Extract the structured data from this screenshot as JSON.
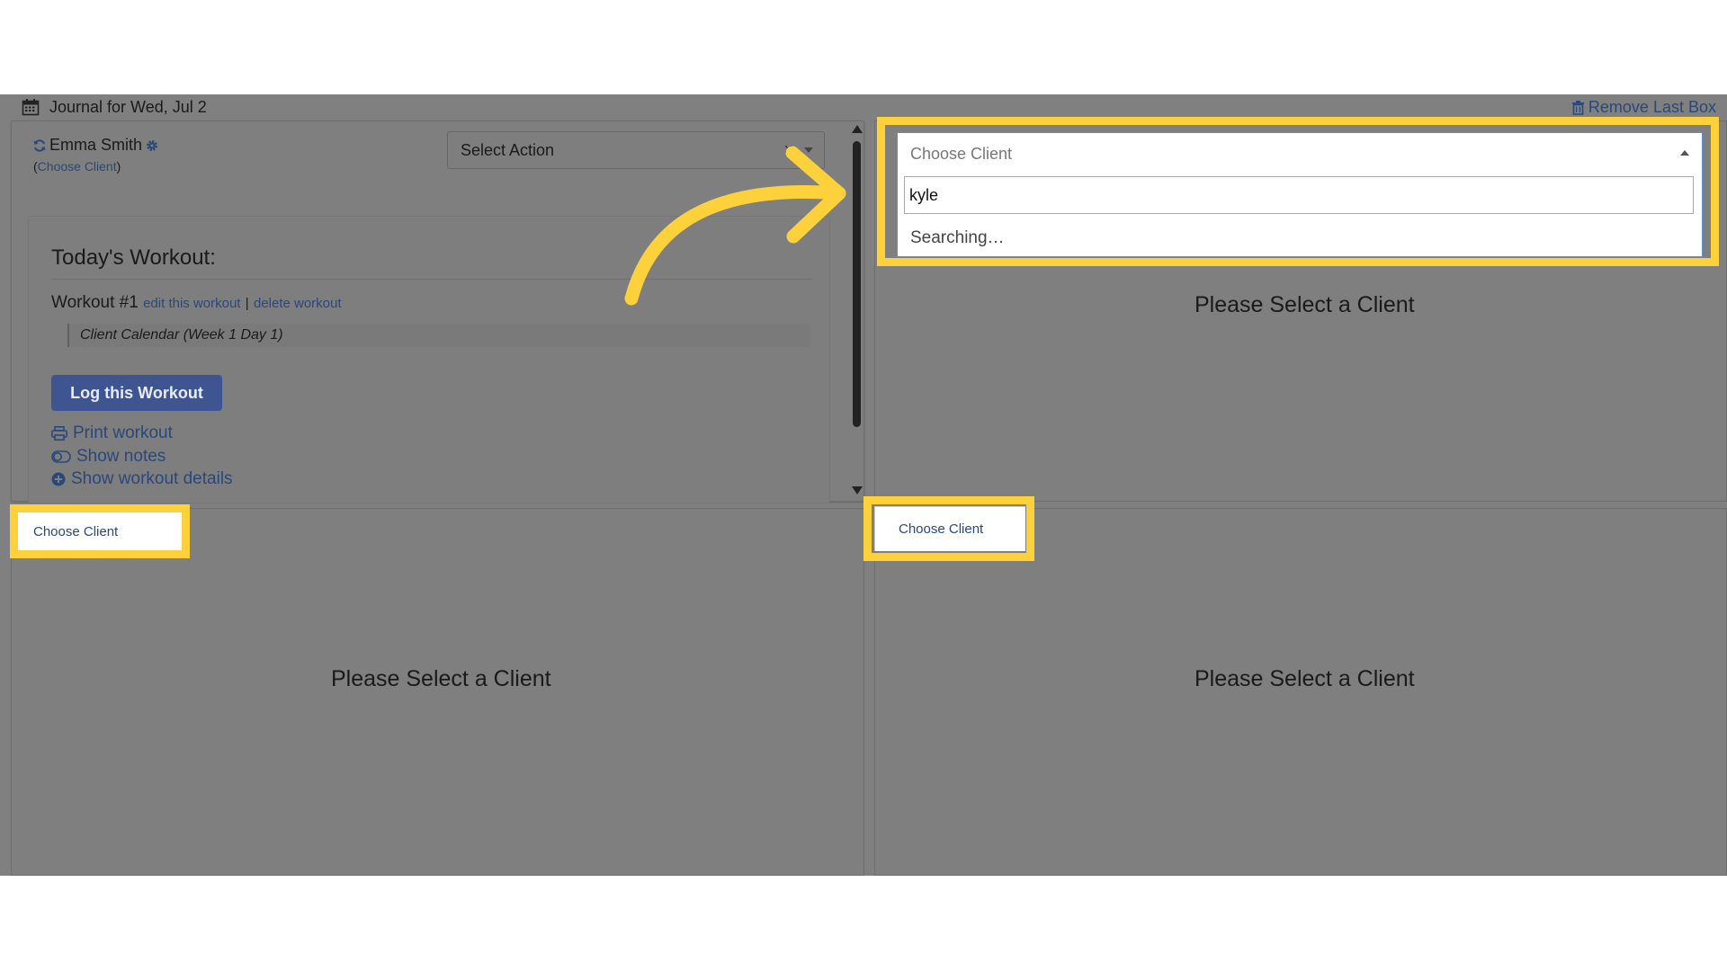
{
  "header": {
    "journal_title": "Journal for Wed, Jul 2",
    "remove_last_box": "Remove Last Box"
  },
  "panel_top_left": {
    "client_name": "Emma Smith",
    "choose_client_open": "(",
    "choose_client_link": "Choose Client",
    "choose_client_close": ")",
    "select_action": {
      "value": "Select Action",
      "clear_symbol": "×"
    },
    "workout": {
      "title": "Today's Workout:",
      "workout_label": "Workout #1",
      "edit_link": "edit this workout",
      "separator": "|",
      "delete_link": "delete workout",
      "calendar_note": "Client Calendar (Week 1 Day 1)",
      "log_button": "Log this Workout",
      "print_link": "Print workout",
      "notes_link": "Show notes",
      "details_link": "Show workout details"
    }
  },
  "panel_top_right": {
    "dropdown": {
      "placeholder": "Choose Client",
      "search_value": "kyle",
      "status": "Searching…"
    },
    "empty_message": "Please Select a Client"
  },
  "panel_bottom_left": {
    "choose_client": "Choose Client",
    "empty_message": "Please Select a Client"
  },
  "panel_bottom_right": {
    "choose_client": "Choose Client",
    "empty_message": "Please Select a Client"
  },
  "colors": {
    "highlight": "#fdd13c",
    "link": "#29487a",
    "button": "#3e5592",
    "overlay": "#808080"
  }
}
